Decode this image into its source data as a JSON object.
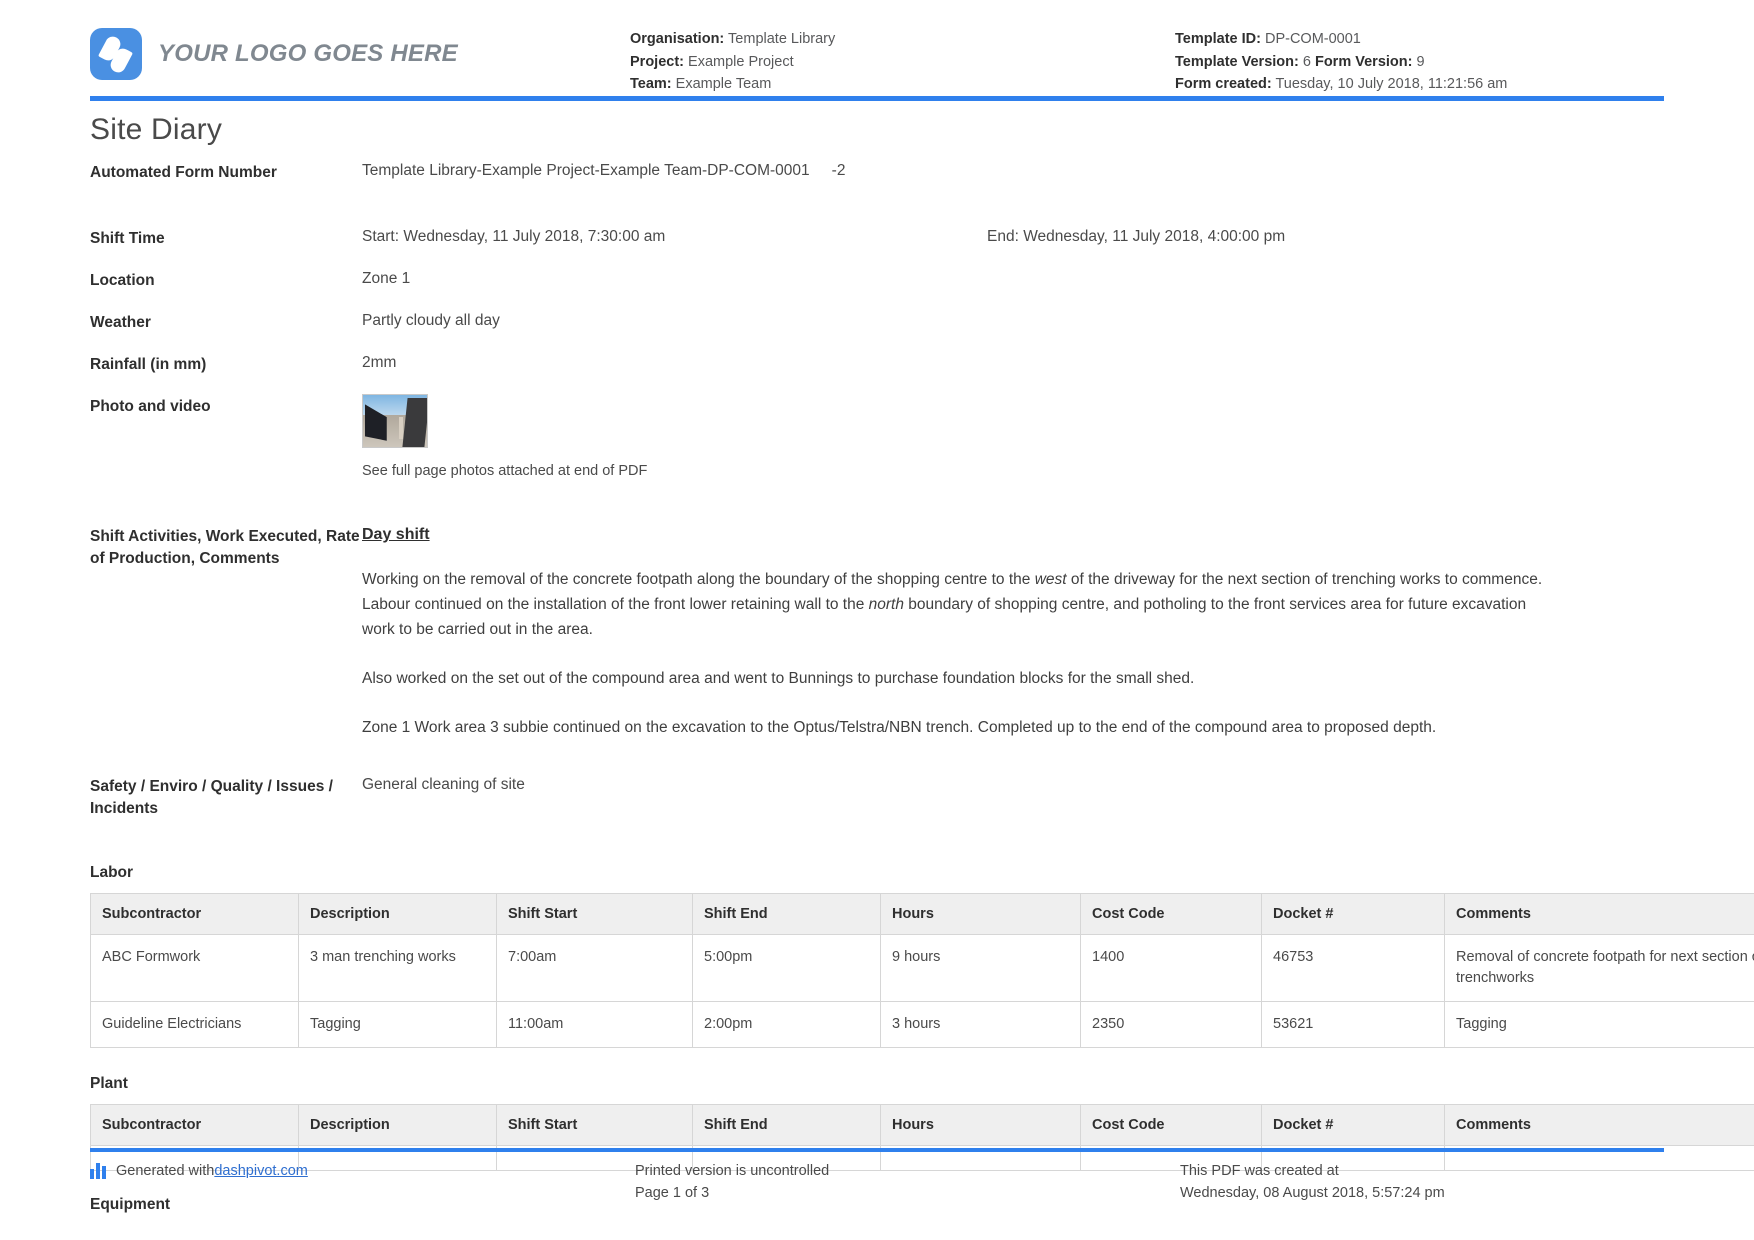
{
  "header": {
    "logo_text": "YOUR LOGO GOES HERE",
    "organisation_label": "Organisation:",
    "organisation_value": "Template Library",
    "project_label": "Project:",
    "project_value": "Example Project",
    "team_label": "Team:",
    "team_value": "Example Team",
    "template_id_label": "Template ID:",
    "template_id_value": "DP-COM-0001",
    "template_version_label": "Template Version:",
    "template_version_value": "6",
    "form_version_label": "Form Version:",
    "form_version_value": "9",
    "form_created_label": "Form created:",
    "form_created_value": "Tuesday, 10 July 2018, 11:21:56 am"
  },
  "title": "Site Diary",
  "fields": {
    "automated_form_number_label": "Automated Form Number",
    "automated_form_number_value": "Template Library-Example Project-Example Team-DP-COM-0001",
    "automated_form_number_suffix": "-2",
    "shift_time_label": "Shift Time",
    "shift_time_start": "Start: Wednesday, 11 July 2018, 7:30:00 am",
    "shift_time_end": "End: Wednesday, 11 July 2018, 4:00:00 pm",
    "location_label": "Location",
    "location_value": "Zone 1",
    "weather_label": "Weather",
    "weather_value": "Partly cloudy all day",
    "rainfall_label": "Rainfall (in mm)",
    "rainfall_value": "2mm",
    "photo_label": "Photo and video",
    "photo_caption": "See full page photos attached at end of PDF",
    "activities_label": "Shift Activities, Work Executed, Rate of Production, Comments",
    "day_shift_heading": "Day shift",
    "paragraph_1_part_1": "Working on the removal of the concrete footpath along the boundary of the shopping centre to the ",
    "paragraph_1_em_1": "west",
    "paragraph_1_part_2": " of the driveway for the next section of trenching works to commence. Labour continued on the installation of the front lower retaining wall to the ",
    "paragraph_1_em_2": "north",
    "paragraph_1_part_3": " boundary of shopping centre, and potholing to the front services area for future excavation work to be carried out in the area.",
    "paragraph_2": "Also worked on the set out of the compound area and went to Bunnings to purchase foundation blocks for the small shed.",
    "paragraph_3": "Zone 1 Work area 3 subbie continued on the excavation to the Optus/Telstra/NBN trench. Completed up to the end of the compound area to proposed depth.",
    "safety_label": "Safety / Enviro / Quality / Issues / Incidents",
    "safety_value": "General cleaning of site"
  },
  "tables": {
    "columns": [
      "Subcontractor",
      "Description",
      "Shift Start",
      "Shift End",
      "Hours",
      "Cost Code",
      "Docket #",
      "Comments"
    ],
    "labor": {
      "title": "Labor",
      "rows": [
        {
          "subcontractor": "ABC Formwork",
          "description": "3 man trenching works",
          "shift_start": "7:00am",
          "shift_end": "5:00pm",
          "hours": "9 hours",
          "cost_code": "1400",
          "docket": "46753",
          "comments": "Removal of concrete footpath for next section of trenchworks"
        },
        {
          "subcontractor": "Guideline Electricians",
          "description": "Tagging",
          "shift_start": "11:00am",
          "shift_end": "2:00pm",
          "hours": "3 hours",
          "cost_code": "2350",
          "docket": "53621",
          "comments": "Tagging"
        }
      ]
    },
    "plant": {
      "title": "Plant",
      "rows": [
        {
          "subcontractor": "",
          "description": "",
          "shift_start": "",
          "shift_end": "",
          "hours": "",
          "cost_code": "",
          "docket": "",
          "comments": ""
        }
      ]
    },
    "equipment": {
      "title": "Equipment"
    }
  },
  "footer": {
    "generated_prefix": "Generated with ",
    "generated_link": "dashpivot.com",
    "uncontrolled": "Printed version is uncontrolled",
    "page": "Page 1 of 3",
    "created_line_1": "This PDF was created at",
    "created_line_2": "Wednesday, 08 August 2018, 5:57:24 pm"
  },
  "colors": {
    "accent": "#2f80ed",
    "logo": "#4a90e2",
    "table_header": "#efefef"
  }
}
